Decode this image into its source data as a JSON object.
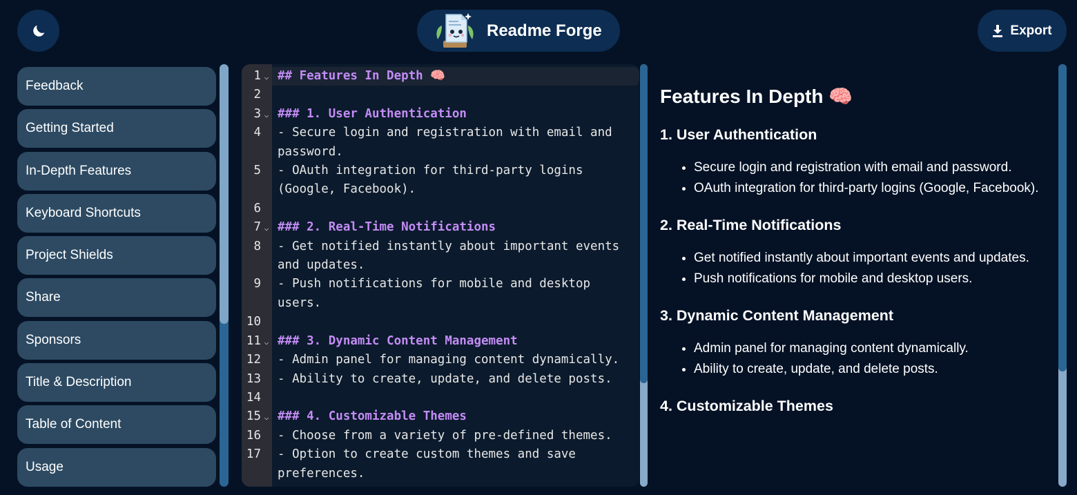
{
  "header": {
    "theme_toggle_icon": "moon-icon",
    "app_title": "Readme Forge",
    "logo_icon": "document-mascot-logo",
    "export_label": "Export",
    "export_icon": "download-icon"
  },
  "sidebar": {
    "items": [
      {
        "label": "Feedback"
      },
      {
        "label": "Getting Started"
      },
      {
        "label": "In-Depth Features"
      },
      {
        "label": "Keyboard Shortcuts"
      },
      {
        "label": "Project Shields"
      },
      {
        "label": "Share"
      },
      {
        "label": "Sponsors"
      },
      {
        "label": "Title & Description"
      },
      {
        "label": "Table of Content"
      },
      {
        "label": "Usage"
      }
    ]
  },
  "editor": {
    "lines": [
      {
        "n": "1",
        "fold": true,
        "heading": true,
        "text": "## Features In Depth 🧠"
      },
      {
        "n": "2",
        "fold": false,
        "heading": false,
        "text": ""
      },
      {
        "n": "3",
        "fold": true,
        "heading": true,
        "text": "### 1. User Authentication"
      },
      {
        "n": "4",
        "fold": false,
        "heading": false,
        "text": "- Secure login and registration with email and password."
      },
      {
        "n": "5",
        "fold": false,
        "heading": false,
        "text": "- OAuth integration for third-party logins (Google, Facebook)."
      },
      {
        "n": "6",
        "fold": false,
        "heading": false,
        "text": ""
      },
      {
        "n": "7",
        "fold": true,
        "heading": true,
        "text": "### 2. Real-Time Notifications"
      },
      {
        "n": "8",
        "fold": false,
        "heading": false,
        "text": "- Get notified instantly about important events and updates."
      },
      {
        "n": "9",
        "fold": false,
        "heading": false,
        "text": "- Push notifications for mobile and desktop users."
      },
      {
        "n": "10",
        "fold": false,
        "heading": false,
        "text": ""
      },
      {
        "n": "11",
        "fold": true,
        "heading": true,
        "text": "### 3. Dynamic Content Management"
      },
      {
        "n": "12",
        "fold": false,
        "heading": false,
        "text": "- Admin panel for managing content dynamically."
      },
      {
        "n": "13",
        "fold": false,
        "heading": false,
        "text": "- Ability to create, update, and delete posts."
      },
      {
        "n": "14",
        "fold": false,
        "heading": false,
        "text": ""
      },
      {
        "n": "15",
        "fold": true,
        "heading": true,
        "text": "### 4. Customizable Themes"
      },
      {
        "n": "16",
        "fold": false,
        "heading": false,
        "text": "- Choose from a variety of pre-defined themes."
      },
      {
        "n": "17",
        "fold": false,
        "heading": false,
        "text": "- Option to create custom themes and save preferences."
      }
    ]
  },
  "preview": {
    "title": "Features In Depth 🧠",
    "sections": [
      {
        "heading": "1. User Authentication",
        "items": [
          "Secure login and registration with email and password.",
          "OAuth integration for third-party logins (Google, Facebook)."
        ]
      },
      {
        "heading": "2. Real-Time Notifications",
        "items": [
          "Get notified instantly about important events and updates.",
          "Push notifications for mobile and desktop users."
        ]
      },
      {
        "heading": "3. Dynamic Content Management",
        "items": [
          "Admin panel for managing content dynamically.",
          "Ability to create, update, and delete posts."
        ]
      },
      {
        "heading": "4. Customizable Themes",
        "items": []
      }
    ]
  },
  "colors": {
    "background": "#051225",
    "button_bg": "#0d2d52",
    "sidebar_item_bg": "#2d4a62",
    "editor_bg": "#0b1a2c",
    "gutter_bg": "#2c2d35",
    "heading_purple": "#c38cf5",
    "scrollbar_dark": "#2b6594",
    "scrollbar_light": "#89a9c8"
  }
}
